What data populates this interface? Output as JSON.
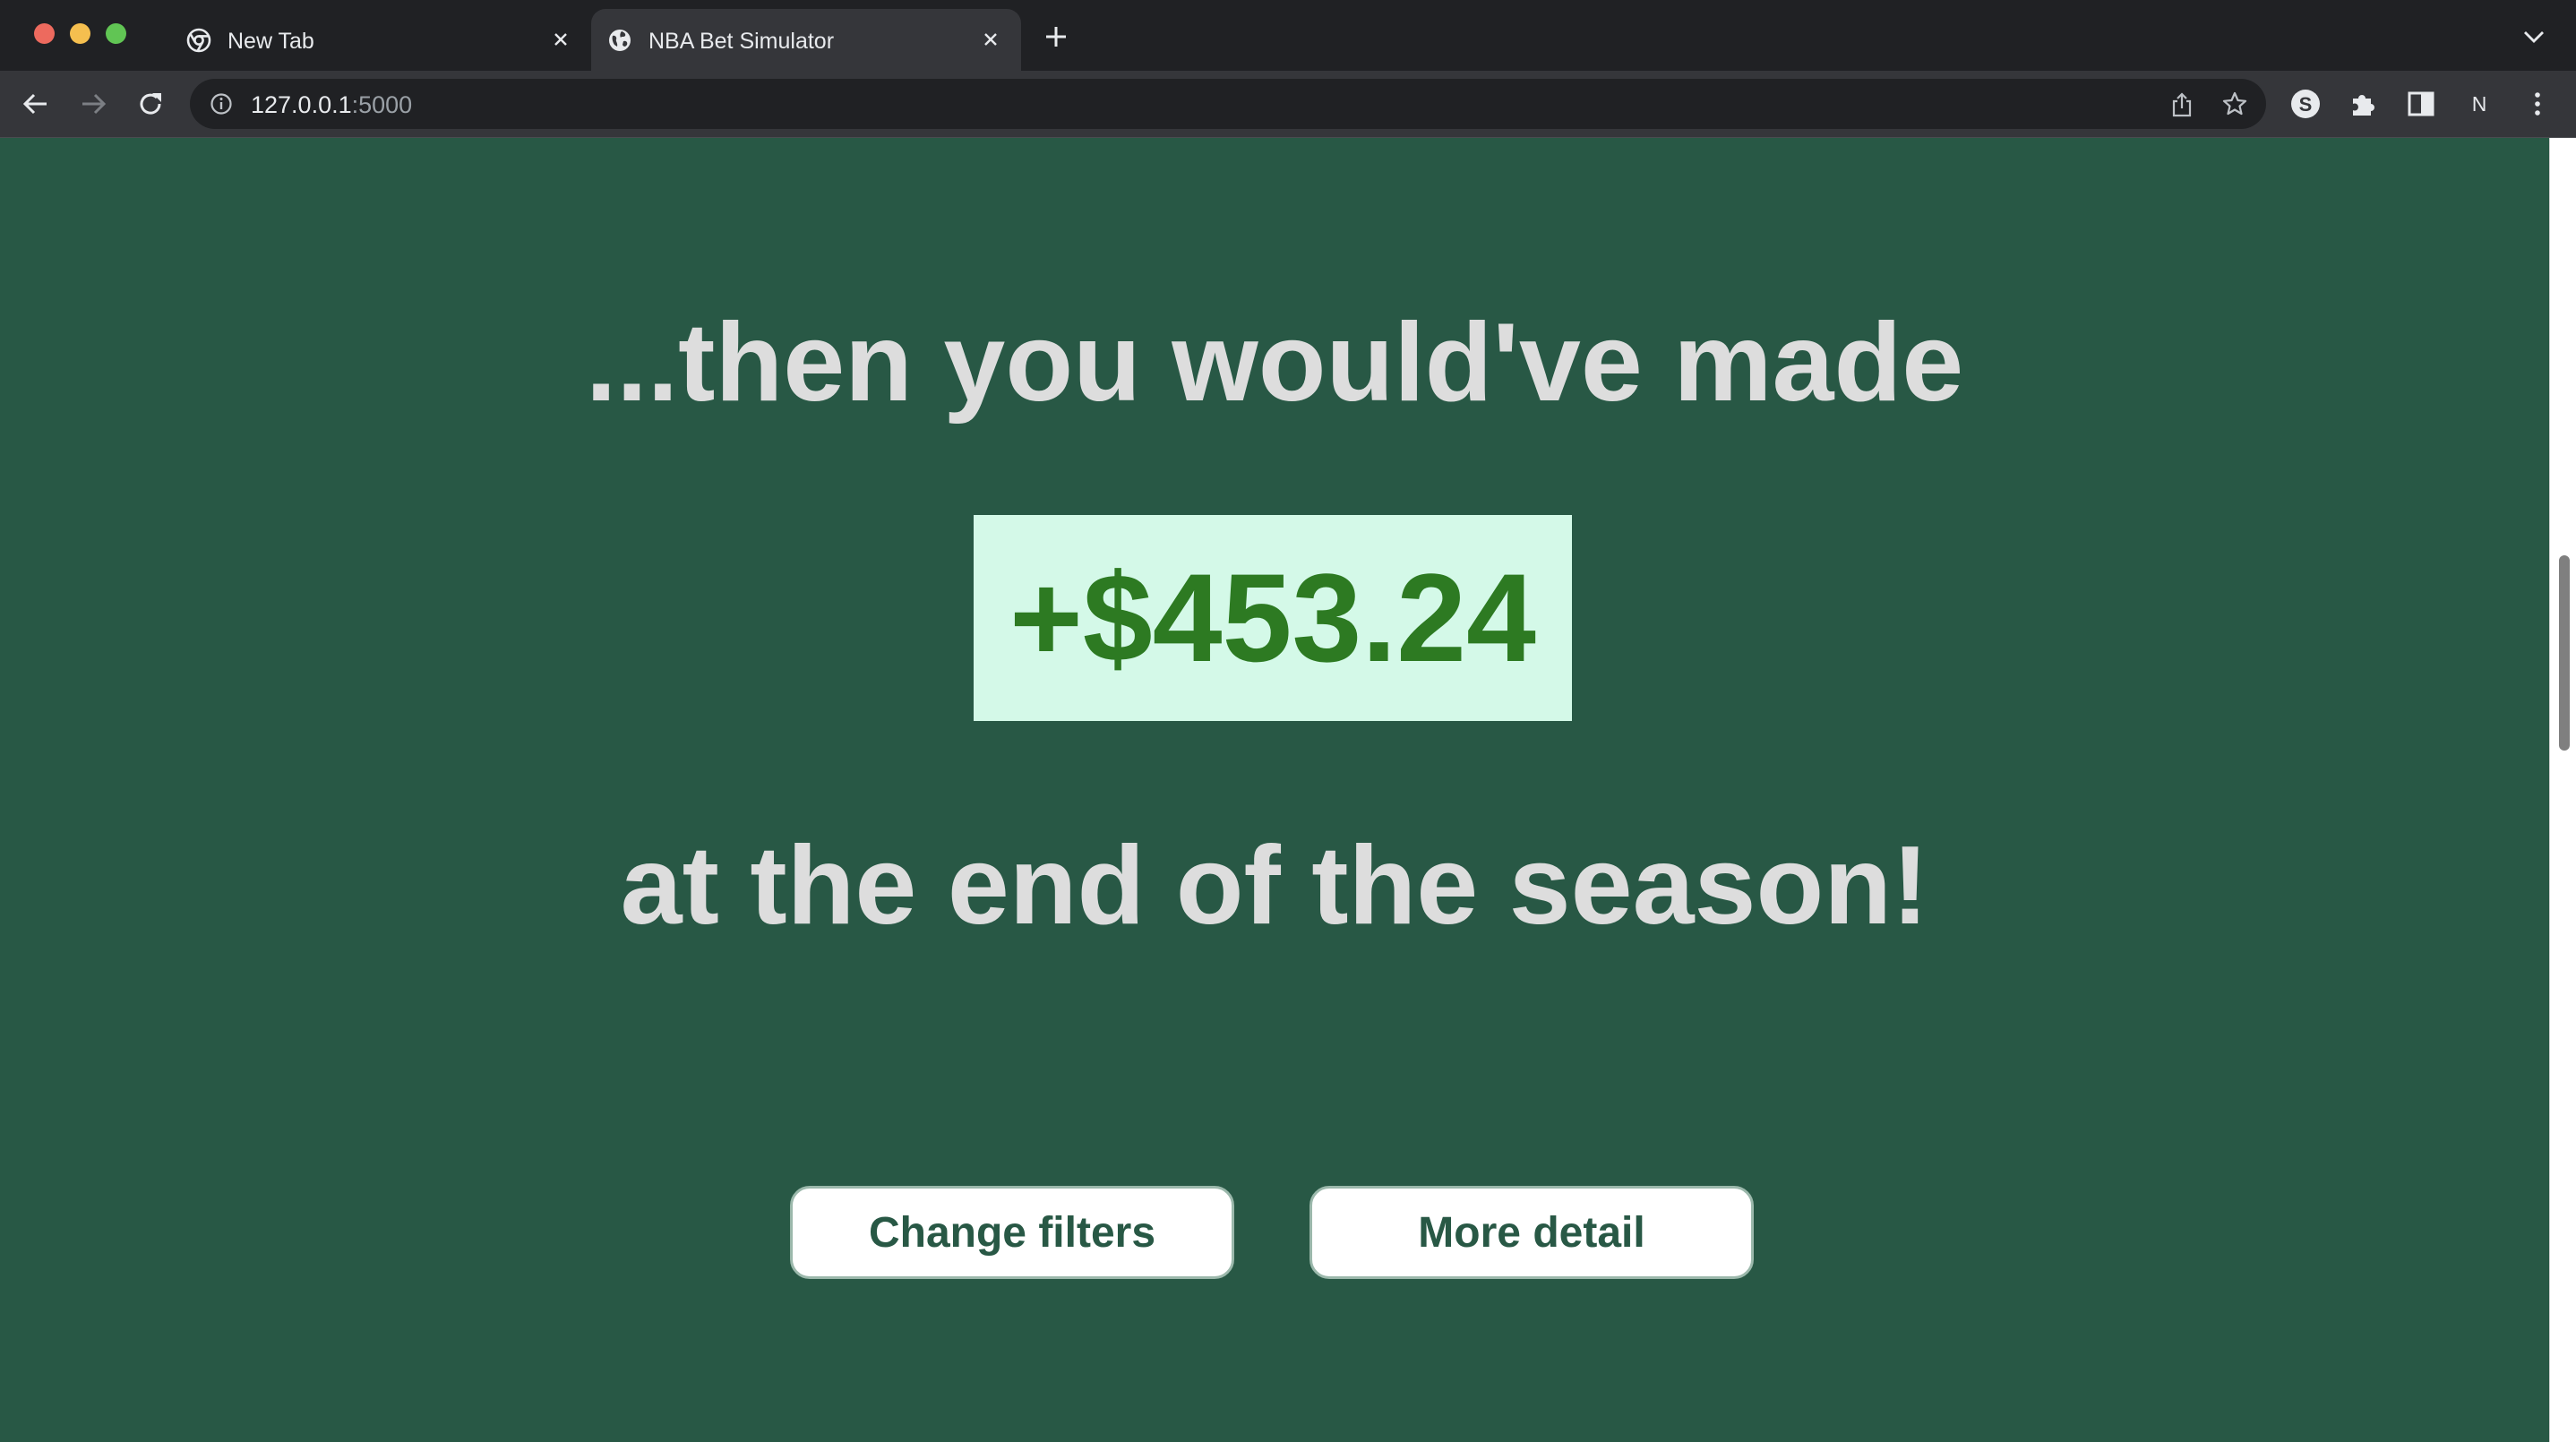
{
  "browser": {
    "tabs": [
      {
        "title": "New Tab",
        "favicon": "chrome-icon",
        "active": false
      },
      {
        "title": "NBA Bet Simulator",
        "favicon": "globe-icon",
        "active": true
      }
    ],
    "address_bar": {
      "host": "127.0.0.1",
      "port": ":5000"
    },
    "profile_initial": "N",
    "icons": {
      "back": "arrow-left-icon",
      "forward": "arrow-right-icon",
      "reload": "reload-icon",
      "info": "info-icon",
      "share": "share-icon",
      "bookmark": "star-icon",
      "extension_s": "s-extension-icon",
      "extensions": "puzzle-icon",
      "side_panel": "side-panel-icon",
      "menu": "kebab-menu-icon",
      "new_tab": "plus-icon",
      "tab_search": "chevron-down-icon"
    }
  },
  "page": {
    "lead_text": "...then you would've made",
    "amount": "+$453.24",
    "trail_text": "at the end of the season!",
    "buttons": {
      "change_filters": "Change filters",
      "more_detail": "More detail"
    },
    "colors": {
      "background": "#285845",
      "headline_text": "#dddddd",
      "amount_box": "#d4f9e8",
      "amount_text": "#2d7a22",
      "button_text": "#285845"
    }
  }
}
